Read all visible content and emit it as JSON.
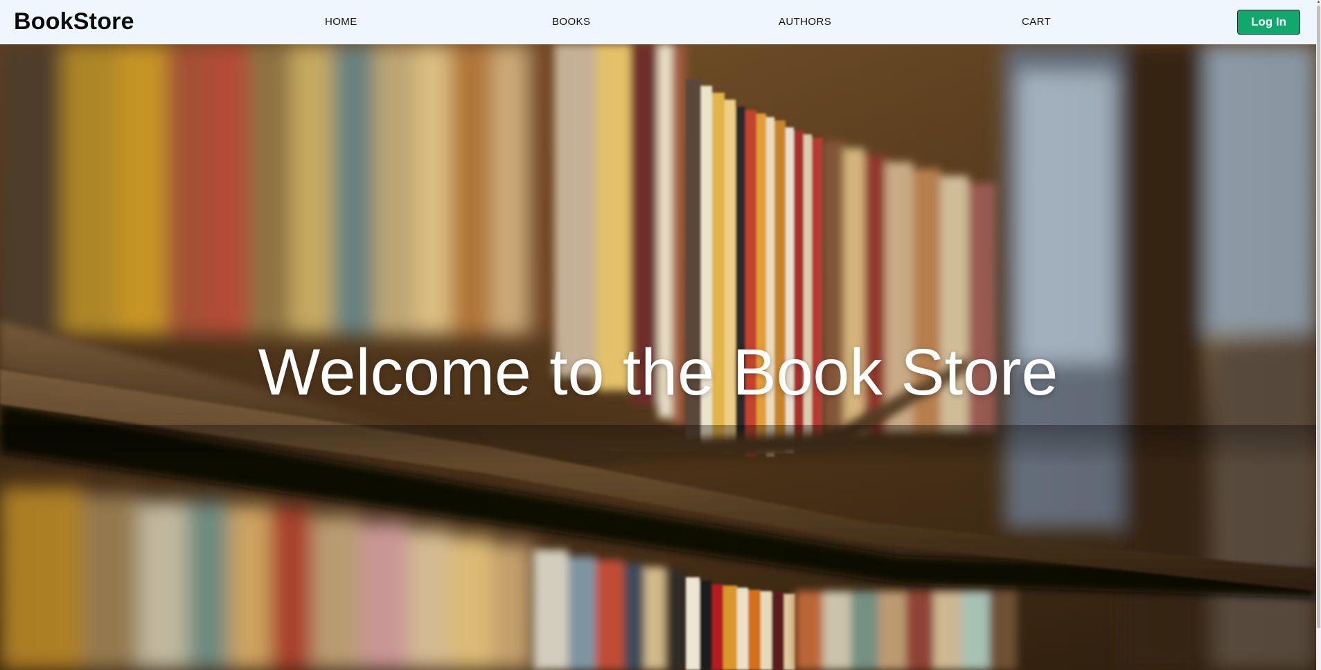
{
  "navbar": {
    "brand": "BookStore",
    "links": [
      {
        "label": "HOME"
      },
      {
        "label": "BOOKS"
      },
      {
        "label": "AUTHORS"
      },
      {
        "label": "CART"
      }
    ],
    "login_label": "Log In"
  },
  "hero": {
    "title": "Welcome to the Book Store",
    "background": "bookshelf-photo"
  },
  "colors": {
    "navbar_bg": "#eff7fe",
    "login_bg": "#12a86d",
    "login_text": "#ffffff",
    "brand_text": "#0b0b0b",
    "hero_text": "#ffffff"
  },
  "icons": {
    "scroll_up": "chevron-up-icon"
  }
}
